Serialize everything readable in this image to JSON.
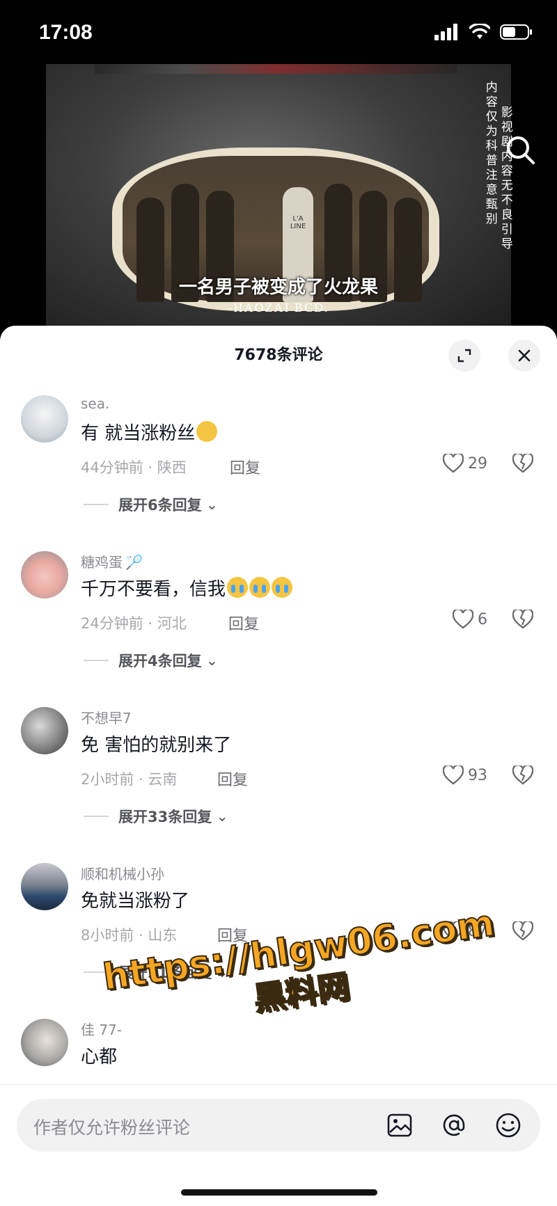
{
  "status_bar": {
    "time": "17:08"
  },
  "video": {
    "subtitle": "一名男子被变成了火龙果",
    "signature": "-HAOZAI BCD.",
    "side_text_right": "影视剧内容无不良引导",
    "side_text_left": "内容仅为科普注意甄别",
    "shirt_text": "L'A LINE"
  },
  "sheet": {
    "title": "7678条评论"
  },
  "comments": [
    {
      "username": "sea.",
      "text": "有 就当涨粉丝",
      "meta": "44分钟前 · 陕西",
      "reply": "回复",
      "likes": "29",
      "expand": "展开6条回复"
    },
    {
      "username": "糖鸡蛋",
      "text": "千万不要看，信我",
      "meta": "24分钟前 · 河北",
      "reply": "回复",
      "likes": "6",
      "expand": "展开4条回复"
    },
    {
      "username": "不想早7",
      "text": "免 害怕的就别来了",
      "meta": "2小时前 · 云南",
      "reply": "回复",
      "likes": "93",
      "expand": "展开33条回复"
    },
    {
      "username": "顺和机械小孙",
      "text": "免就当涨粉了",
      "meta": "8小时前 · 山东",
      "reply": "回复",
      "likes": "87",
      "expand": "展开21条回复"
    },
    {
      "username": "佳 77-",
      "text": "心都"
    }
  ],
  "watermark": {
    "url": "https://hlgw06.com",
    "name": "黑料网"
  },
  "input": {
    "placeholder": "作者仅允许粉丝评论"
  },
  "icons": {
    "search": "search-icon",
    "expand": "expand-icon",
    "close": "close-icon",
    "heart": "heart-icon",
    "dislike": "broken-heart-icon",
    "image": "image-icon",
    "mention": "at-icon",
    "emoji": "emoji-icon"
  }
}
